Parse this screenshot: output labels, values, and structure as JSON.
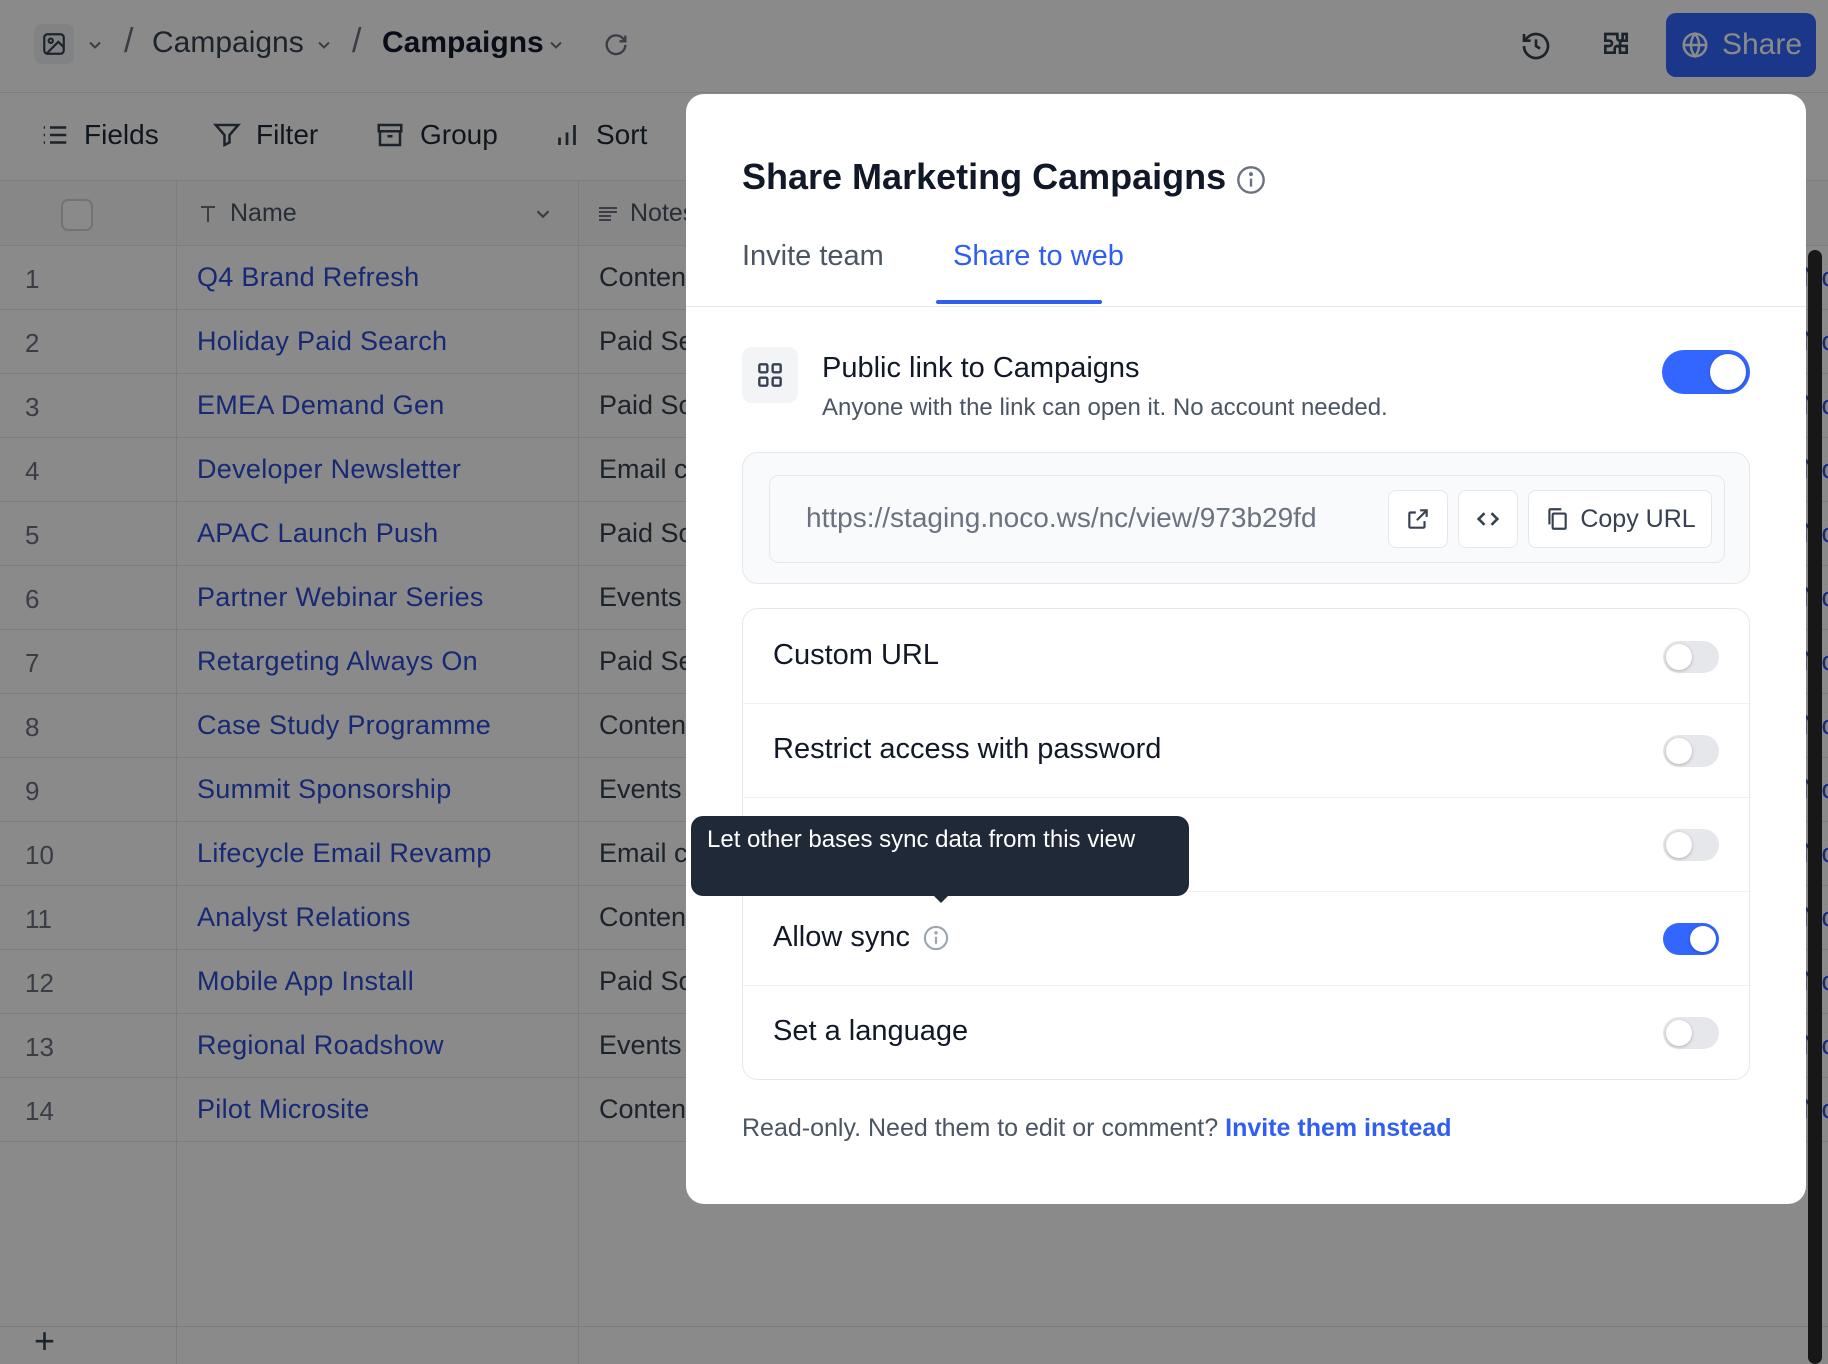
{
  "breadcrumb": {
    "base_crumb": "Campaigns",
    "table_crumb": "Campaigns",
    "separator": "/"
  },
  "topbar": {
    "share_label": "Share"
  },
  "toolbar": {
    "fields_label": "Fields",
    "filter_label": "Filter",
    "group_label": "Group",
    "sort_label": "Sort"
  },
  "grid": {
    "columns": {
      "name": "Name",
      "notes": "Notes"
    },
    "rows": [
      {
        "num": "1",
        "name": "Q4 Brand Refresh",
        "notes": "Content",
        "extra": "No"
      },
      {
        "num": "2",
        "name": "Holiday Paid Search",
        "notes": "Paid Se",
        "extra": "No"
      },
      {
        "num": "3",
        "name": "EMEA Demand Gen",
        "notes": "Paid So",
        "extra": "No"
      },
      {
        "num": "4",
        "name": "Developer Newsletter",
        "notes": "Email c",
        "extra": "No"
      },
      {
        "num": "5",
        "name": "APAC Launch Push",
        "notes": "Paid So",
        "extra": "No"
      },
      {
        "num": "6",
        "name": "Partner Webinar Series",
        "notes": "Events",
        "extra": "No"
      },
      {
        "num": "7",
        "name": "Retargeting Always On",
        "notes": "Paid Se",
        "extra": "No"
      },
      {
        "num": "8",
        "name": "Case Study Programme",
        "notes": "Content",
        "extra": "No"
      },
      {
        "num": "9",
        "name": "Summit Sponsorship",
        "notes": "Events",
        "extra": "No"
      },
      {
        "num": "10",
        "name": "Lifecycle Email Revamp",
        "notes": "Email c",
        "extra": "No"
      },
      {
        "num": "11",
        "name": "Analyst Relations",
        "notes": "Content",
        "extra": "No"
      },
      {
        "num": "12",
        "name": "Mobile App Install",
        "notes": "Paid So",
        "extra": "No"
      },
      {
        "num": "13",
        "name": "Regional Roadshow",
        "notes": "Events",
        "extra": "No"
      },
      {
        "num": "14",
        "name": "Pilot Microsite",
        "notes": "Content",
        "extra": "No"
      }
    ],
    "add_row": "+"
  },
  "modal": {
    "title": "Share Marketing Campaigns",
    "tabs": [
      {
        "label": "Invite team",
        "active": false
      },
      {
        "label": "Share to web",
        "active": true
      }
    ],
    "public_link": {
      "title": "Public link to Campaigns",
      "subtitle": "Anyone with the link can open it. No account needed.",
      "enabled": true
    },
    "url": {
      "value": "https://staging.noco.ws/nc/view/973b29fd",
      "copy_label": "Copy URL"
    },
    "options": [
      {
        "label": "Custom URL",
        "enabled": false,
        "has_info": false
      },
      {
        "label": "Restrict access with password",
        "enabled": false,
        "has_info": false
      },
      {
        "label": "",
        "enabled": false,
        "has_info": false
      },
      {
        "label": "Allow sync",
        "enabled": true,
        "has_info": true
      },
      {
        "label": "Set a language",
        "enabled": false,
        "has_info": false
      }
    ],
    "footer_text": "Read-only. Need them to edit or comment?",
    "footer_link": "Invite them instead"
  },
  "tooltip": {
    "text": "Let other bases sync data from this view"
  },
  "colors": {
    "accent": "#3366ff",
    "link": "#2b4bd6",
    "tooltip_bg": "#1f2937"
  }
}
